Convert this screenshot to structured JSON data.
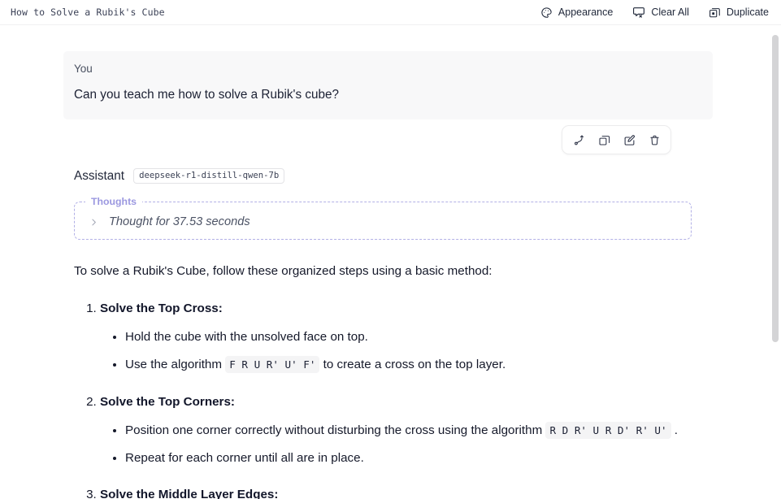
{
  "titlebar": {
    "title": "How to Solve a Rubik's Cube",
    "actions": [
      {
        "label": "Appearance",
        "icon": "palette-icon"
      },
      {
        "label": "Clear All",
        "icon": "message-x-icon"
      },
      {
        "label": "Duplicate",
        "icon": "copy-icon"
      }
    ]
  },
  "conversation": {
    "user": {
      "role_label": "You",
      "text": "Can you teach me how to solve a Rubik's cube?"
    },
    "message_actions": [
      {
        "name": "branch-icon",
        "title": "Branch"
      },
      {
        "name": "copy-icon",
        "title": "Copy"
      },
      {
        "name": "edit-icon",
        "title": "Edit"
      },
      {
        "name": "trash-icon",
        "title": "Delete"
      }
    ],
    "assistant": {
      "role_label": "Assistant",
      "model": "deepseek-r1-distill-qwen-7b",
      "thoughts": {
        "legend": "Thoughts",
        "summary": "Thought for 37.53 seconds",
        "expanded": false
      },
      "answer": {
        "intro": "To solve a Rubik's Cube, follow these organized steps using a basic method:",
        "steps": [
          {
            "title": "Solve the Top Cross:",
            "bullets": [
              {
                "parts": [
                  {
                    "type": "text",
                    "value": "Hold the cube with the unsolved face on top."
                  }
                ]
              },
              {
                "parts": [
                  {
                    "type": "text",
                    "value": "Use the algorithm "
                  },
                  {
                    "type": "code",
                    "value": "F R U R' U' F'"
                  },
                  {
                    "type": "text",
                    "value": " to create a cross on the top layer."
                  }
                ]
              }
            ]
          },
          {
            "title": "Solve the Top Corners:",
            "bullets": [
              {
                "parts": [
                  {
                    "type": "text",
                    "value": "Position one corner correctly without disturbing the cross using the algorithm "
                  },
                  {
                    "type": "code",
                    "value": "R D R' U R D' R' U'"
                  },
                  {
                    "type": "text",
                    "value": " ."
                  }
                ]
              },
              {
                "parts": [
                  {
                    "type": "text",
                    "value": "Repeat for each corner until all are in place."
                  }
                ]
              }
            ]
          },
          {
            "title": "Solve the Middle Layer Edges:",
            "bullets": []
          }
        ]
      }
    }
  },
  "colors": {
    "accent_thoughts": "#a5a2e6",
    "user_bubble_bg": "#f8f8f9",
    "code_bg": "#f4f4f5",
    "scrollbar": "#d4d4d6"
  }
}
